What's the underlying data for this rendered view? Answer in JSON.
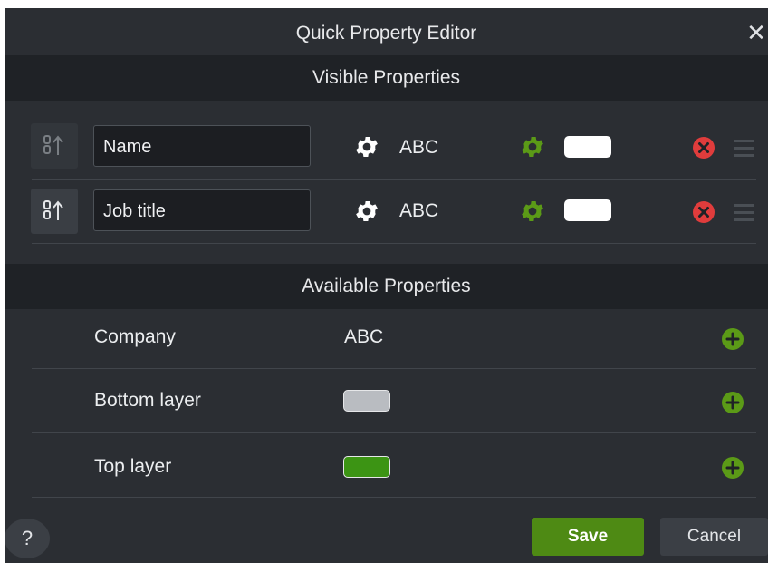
{
  "dialog": {
    "title": "Quick Property Editor",
    "close_icon": "close-icon"
  },
  "visible_section": {
    "header": "Visible Properties",
    "rows": [
      {
        "name": "Name",
        "type": "ABC",
        "swatch_color": "#ffffff",
        "gear_color": "#ffffff",
        "gear_accent_color": "#5b9a17",
        "remove_color": "#e03c3c"
      },
      {
        "name": "Job title",
        "type": "ABC",
        "swatch_color": "#ffffff",
        "gear_color": "#ffffff",
        "gear_accent_color": "#5b9a17",
        "remove_color": "#e03c3c"
      }
    ]
  },
  "available_section": {
    "header": "Available Properties",
    "items": [
      {
        "label": "Company",
        "value": "ABC"
      },
      {
        "label": "Bottom layer",
        "swatch_color": "#b9bcc1"
      },
      {
        "label": "Top layer",
        "swatch_color": "#3c9414"
      }
    ],
    "add_color": "#5b9a17"
  },
  "footer": {
    "help_label": "?",
    "save_label": "Save",
    "cancel_label": "Cancel"
  }
}
